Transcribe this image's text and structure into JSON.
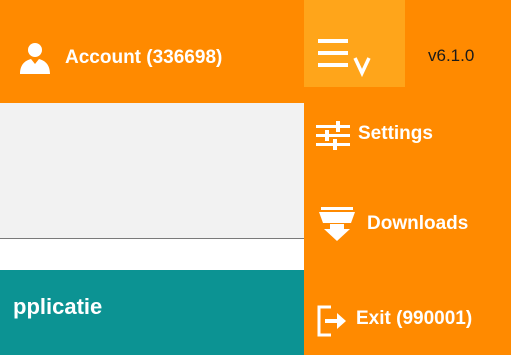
{
  "header": {
    "account_label": "Account (336698)",
    "version": "v6.1.0",
    "account_icon": "user-icon",
    "menu_icon": "hamburger-chevron-down-icon"
  },
  "main": {
    "banner_text": "pplicatie"
  },
  "menu": {
    "items": [
      {
        "label": "Settings",
        "icon": "sliders-icon"
      },
      {
        "label": "Downloads",
        "icon": "download-tray-icon"
      },
      {
        "label": "Exit (990001)",
        "icon": "exit-icon"
      }
    ]
  },
  "colors": {
    "accent": "#ff8a00",
    "toggle_highlight": "#ffa51a",
    "teal": "#0c9393",
    "panel_gray": "#f2f2f2"
  }
}
